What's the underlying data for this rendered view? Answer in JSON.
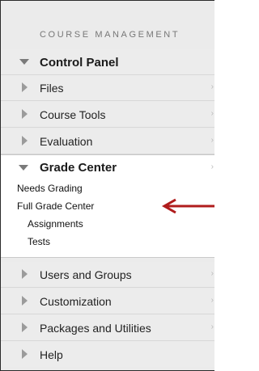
{
  "section_heading": "COURSE MANAGEMENT",
  "control_panel": {
    "label": "Control Panel"
  },
  "items_top": [
    {
      "label": "Files"
    },
    {
      "label": "Course Tools"
    },
    {
      "label": "Evaluation"
    }
  ],
  "grade_center": {
    "label": "Grade Center",
    "links": [
      {
        "label": "Needs Grading"
      },
      {
        "label": "Full Grade Center"
      }
    ],
    "sub_links": [
      {
        "label": "Assignments"
      },
      {
        "label": "Tests"
      }
    ]
  },
  "items_bottom": [
    {
      "label": "Users and Groups"
    },
    {
      "label": "Customization"
    },
    {
      "label": "Packages and Utilities"
    },
    {
      "label": "Help"
    }
  ],
  "colors": {
    "panel_bg": "#ebebeb",
    "expanded_bg": "#ffffff",
    "annotation_arrow": "#b01c1c"
  },
  "icons": {
    "collapsed": "triangle-right-icon",
    "expanded": "triangle-down-icon",
    "chevron": "chevron-right-icon"
  }
}
